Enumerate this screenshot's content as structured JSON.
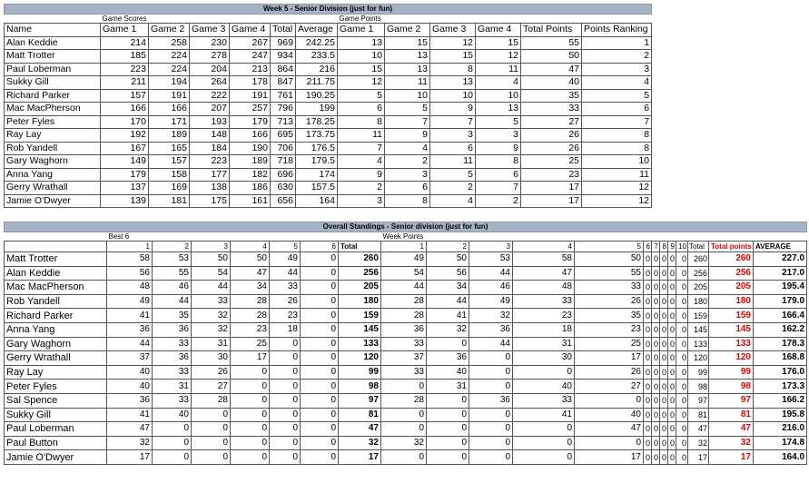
{
  "week": {
    "title": "Week 5 - Senior Division (just for fun)",
    "scores_group": "Game Scores",
    "points_group": "Game Points",
    "columns": [
      "Name",
      "Game 1",
      "Game 2",
      "Game 3",
      "Game 4",
      "Total",
      "Average",
      "Game 1",
      "Game 2",
      "Game 3",
      "Game 4",
      "Total Points",
      "Points Ranking"
    ],
    "rows": [
      [
        "Alan Keddie",
        "214",
        "258",
        "230",
        "267",
        "969",
        "242.25",
        "13",
        "15",
        "12",
        "15",
        "55",
        "1"
      ],
      [
        "Matt Trotter",
        "185",
        "224",
        "278",
        "247",
        "934",
        "233.5",
        "10",
        "13",
        "15",
        "12",
        "50",
        "2"
      ],
      [
        "Paul Loberman",
        "223",
        "224",
        "204",
        "213",
        "864",
        "216",
        "15",
        "13",
        "8",
        "11",
        "47",
        "3"
      ],
      [
        "Sukky Gill",
        "211",
        "194",
        "264",
        "178",
        "847",
        "211.75",
        "12",
        "11",
        "13",
        "4",
        "40",
        "4"
      ],
      [
        "Richard Parker",
        "157",
        "191",
        "222",
        "191",
        "761",
        "190.25",
        "5",
        "10",
        "10",
        "10",
        "35",
        "5"
      ],
      [
        "Mac MacPherson",
        "166",
        "166",
        "207",
        "257",
        "796",
        "199",
        "6",
        "5",
        "9",
        "13",
        "33",
        "6"
      ],
      [
        "Peter Fyles",
        "170",
        "171",
        "193",
        "179",
        "713",
        "178.25",
        "8",
        "7",
        "7",
        "5",
        "27",
        "7"
      ],
      [
        "Ray Lay",
        "192",
        "189",
        "148",
        "166",
        "695",
        "173.75",
        "11",
        "9",
        "3",
        "3",
        "26",
        "8"
      ],
      [
        "Rob Yandell",
        "167",
        "165",
        "184",
        "190",
        "706",
        "176.5",
        "7",
        "4",
        "6",
        "9",
        "26",
        "8"
      ],
      [
        "Gary Waghorn",
        "149",
        "157",
        "223",
        "189",
        "718",
        "179.5",
        "4",
        "2",
        "11",
        "8",
        "25",
        "10"
      ],
      [
        "Anna Yang",
        "179",
        "158",
        "177",
        "182",
        "696",
        "174",
        "9",
        "3",
        "5",
        "6",
        "23",
        "11"
      ],
      [
        "Gerry Wrathall",
        "137",
        "169",
        "138",
        "186",
        "630",
        "157.5",
        "2",
        "6",
        "2",
        "7",
        "17",
        "12"
      ],
      [
        "Jamie O'Dwyer",
        "139",
        "181",
        "175",
        "161",
        "656",
        "164",
        "3",
        "8",
        "4",
        "2",
        "17",
        "12"
      ]
    ]
  },
  "overall": {
    "title": "Overall Standings - Senior division (just for fun)",
    "best_label": "Best 6",
    "week_points_label": "Week Points",
    "header": [
      "",
      "1",
      "2",
      "3",
      "4",
      "5",
      "6",
      "Total",
      "1",
      "2",
      "3",
      "4",
      "5",
      "6",
      "7",
      "8",
      "9",
      "10",
      "Total",
      "Total points",
      "AVERAGE"
    ],
    "rows": [
      [
        "Matt Trotter",
        "58",
        "53",
        "50",
        "50",
        "49",
        "0",
        "260",
        "49",
        "50",
        "53",
        "58",
        "50",
        "0",
        "0",
        "0",
        "0",
        "0",
        "260",
        "260",
        "227.0"
      ],
      [
        "Alan Keddie",
        "56",
        "55",
        "54",
        "47",
        "44",
        "0",
        "256",
        "54",
        "56",
        "44",
        "47",
        "55",
        "0",
        "0",
        "0",
        "0",
        "0",
        "256",
        "256",
        "217.0"
      ],
      [
        "Mac MacPherson",
        "48",
        "46",
        "44",
        "34",
        "33",
        "0",
        "205",
        "44",
        "34",
        "46",
        "48",
        "33",
        "0",
        "0",
        "0",
        "0",
        "0",
        "205",
        "205",
        "195.4"
      ],
      [
        "Rob Yandell",
        "49",
        "44",
        "33",
        "28",
        "26",
        "0",
        "180",
        "28",
        "44",
        "49",
        "33",
        "26",
        "0",
        "0",
        "0",
        "0",
        "0",
        "180",
        "180",
        "179.0"
      ],
      [
        "Richard Parker",
        "41",
        "35",
        "32",
        "28",
        "23",
        "0",
        "159",
        "28",
        "41",
        "32",
        "23",
        "35",
        "0",
        "0",
        "0",
        "0",
        "0",
        "159",
        "159",
        "166.4"
      ],
      [
        "Anna Yang",
        "36",
        "36",
        "32",
        "23",
        "18",
        "0",
        "145",
        "36",
        "32",
        "36",
        "18",
        "23",
        "0",
        "0",
        "0",
        "0",
        "0",
        "145",
        "145",
        "162.2"
      ],
      [
        "Gary Waghorn",
        "44",
        "33",
        "31",
        "25",
        "0",
        "0",
        "133",
        "33",
        "0",
        "44",
        "31",
        "25",
        "0",
        "0",
        "0",
        "0",
        "0",
        "133",
        "133",
        "178.3"
      ],
      [
        "Gerry Wrathall",
        "37",
        "36",
        "30",
        "17",
        "0",
        "0",
        "120",
        "37",
        "36",
        "0",
        "30",
        "17",
        "0",
        "0",
        "0",
        "0",
        "0",
        "120",
        "120",
        "168.8"
      ],
      [
        "Ray Lay",
        "40",
        "33",
        "26",
        "0",
        "0",
        "0",
        "99",
        "33",
        "40",
        "0",
        "0",
        "26",
        "0",
        "0",
        "0",
        "0",
        "0",
        "99",
        "99",
        "176.0"
      ],
      [
        "Peter Fyles",
        "40",
        "31",
        "27",
        "0",
        "0",
        "0",
        "98",
        "0",
        "31",
        "0",
        "40",
        "27",
        "0",
        "0",
        "0",
        "0",
        "0",
        "98",
        "98",
        "173.3"
      ],
      [
        "Sal Spence",
        "36",
        "33",
        "28",
        "0",
        "0",
        "0",
        "97",
        "28",
        "0",
        "36",
        "33",
        "0",
        "0",
        "0",
        "0",
        "0",
        "0",
        "97",
        "97",
        "166.2"
      ],
      [
        "Sukky Gill",
        "41",
        "40",
        "0",
        "0",
        "0",
        "0",
        "81",
        "0",
        "0",
        "0",
        "41",
        "40",
        "0",
        "0",
        "0",
        "0",
        "0",
        "81",
        "81",
        "195.8"
      ],
      [
        "Paul Loberman",
        "47",
        "0",
        "0",
        "0",
        "0",
        "0",
        "47",
        "0",
        "0",
        "0",
        "0",
        "47",
        "0",
        "0",
        "0",
        "0",
        "0",
        "47",
        "47",
        "216.0"
      ],
      [
        "Paul Button",
        "32",
        "0",
        "0",
        "0",
        "0",
        "0",
        "32",
        "32",
        "0",
        "0",
        "0",
        "0",
        "0",
        "0",
        "0",
        "0",
        "0",
        "32",
        "32",
        "174.8"
      ],
      [
        "Jamie O'Dwyer",
        "17",
        "0",
        "0",
        "0",
        "0",
        "0",
        "17",
        "0",
        "0",
        "0",
        "0",
        "17",
        "0",
        "0",
        "0",
        "0",
        "0",
        "17",
        "17",
        "164.0"
      ]
    ]
  }
}
